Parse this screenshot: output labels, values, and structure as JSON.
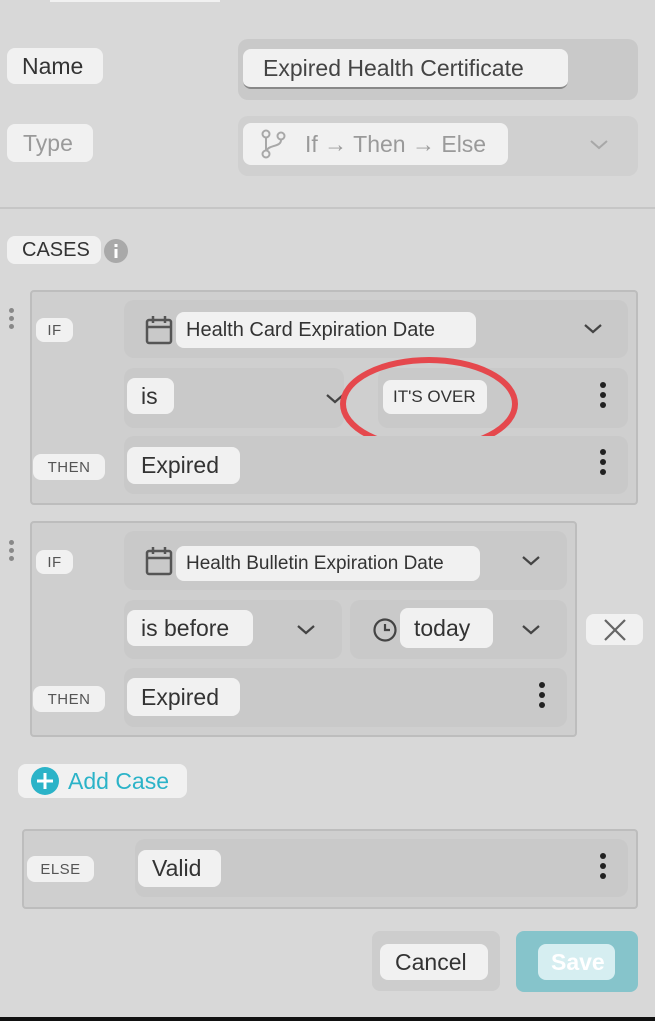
{
  "form": {
    "name_label": "Name",
    "name_value": "Expired Health Certificate",
    "type_label": "Type",
    "type_value": "If → Then → Else",
    "cases_label": "CASES"
  },
  "cases": [
    {
      "if_tag": "IF",
      "field": "Health Card Expiration Date",
      "operator": "is",
      "value": "IT'S OVER",
      "then_tag": "THEN",
      "then_value": "Expired"
    },
    {
      "if_tag": "IF",
      "field": "Health Bulletin Expiration Date",
      "operator": "is before",
      "value": "today",
      "then_tag": "THEN",
      "then_value": "Expired"
    }
  ],
  "add_case_label": "Add Case",
  "else": {
    "tag": "ELSE",
    "value": "Valid"
  },
  "buttons": {
    "cancel": "Cancel",
    "save": "Save"
  },
  "colors": {
    "accent": "#2bb3c8",
    "annotation": "#e5484d",
    "save_bg": "#86c4cb"
  },
  "icons": [
    "calendar-icon",
    "branch-icon",
    "clock-icon",
    "info-icon",
    "chevron-down-icon",
    "kebab-menu-icon",
    "close-icon",
    "plus-circle-icon",
    "drag-handle-icon"
  ]
}
